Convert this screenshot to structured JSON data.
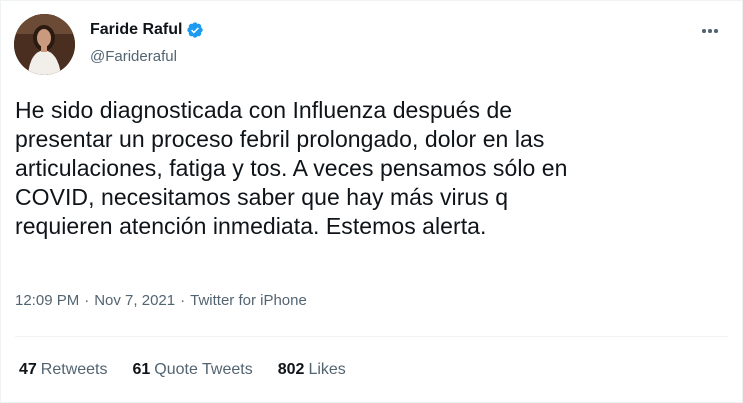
{
  "author": {
    "display_name": "Faride Raful",
    "handle": "@Farideraful",
    "verified": true
  },
  "icons": {
    "verified": "verified-badge-icon",
    "more": "more-options-icon"
  },
  "tweet": {
    "lines": [
      "He sido diagnosticada con Influenza después de",
      "presentar un proceso febril prolongado, dolor en las",
      "articulaciones, fatiga y tos. A veces pensamos sólo en",
      "COVID, necesitamos saber que hay más virus q",
      "requieren atención inmediata. Estemos alerta."
    ]
  },
  "meta": {
    "time": "12:09 PM",
    "date": "Nov 7, 2021",
    "source": "Twitter for iPhone",
    "separator": "·"
  },
  "stats": {
    "retweets_count": "47",
    "retweets_label": "Retweets",
    "quotes_count": "61",
    "quotes_label": "Quote Tweets",
    "likes_count": "802",
    "likes_label": "Likes"
  },
  "colors": {
    "verified": "#1d9bf0",
    "text": "#0f1419",
    "secondary": "#536471",
    "divider": "#eff3f4"
  }
}
